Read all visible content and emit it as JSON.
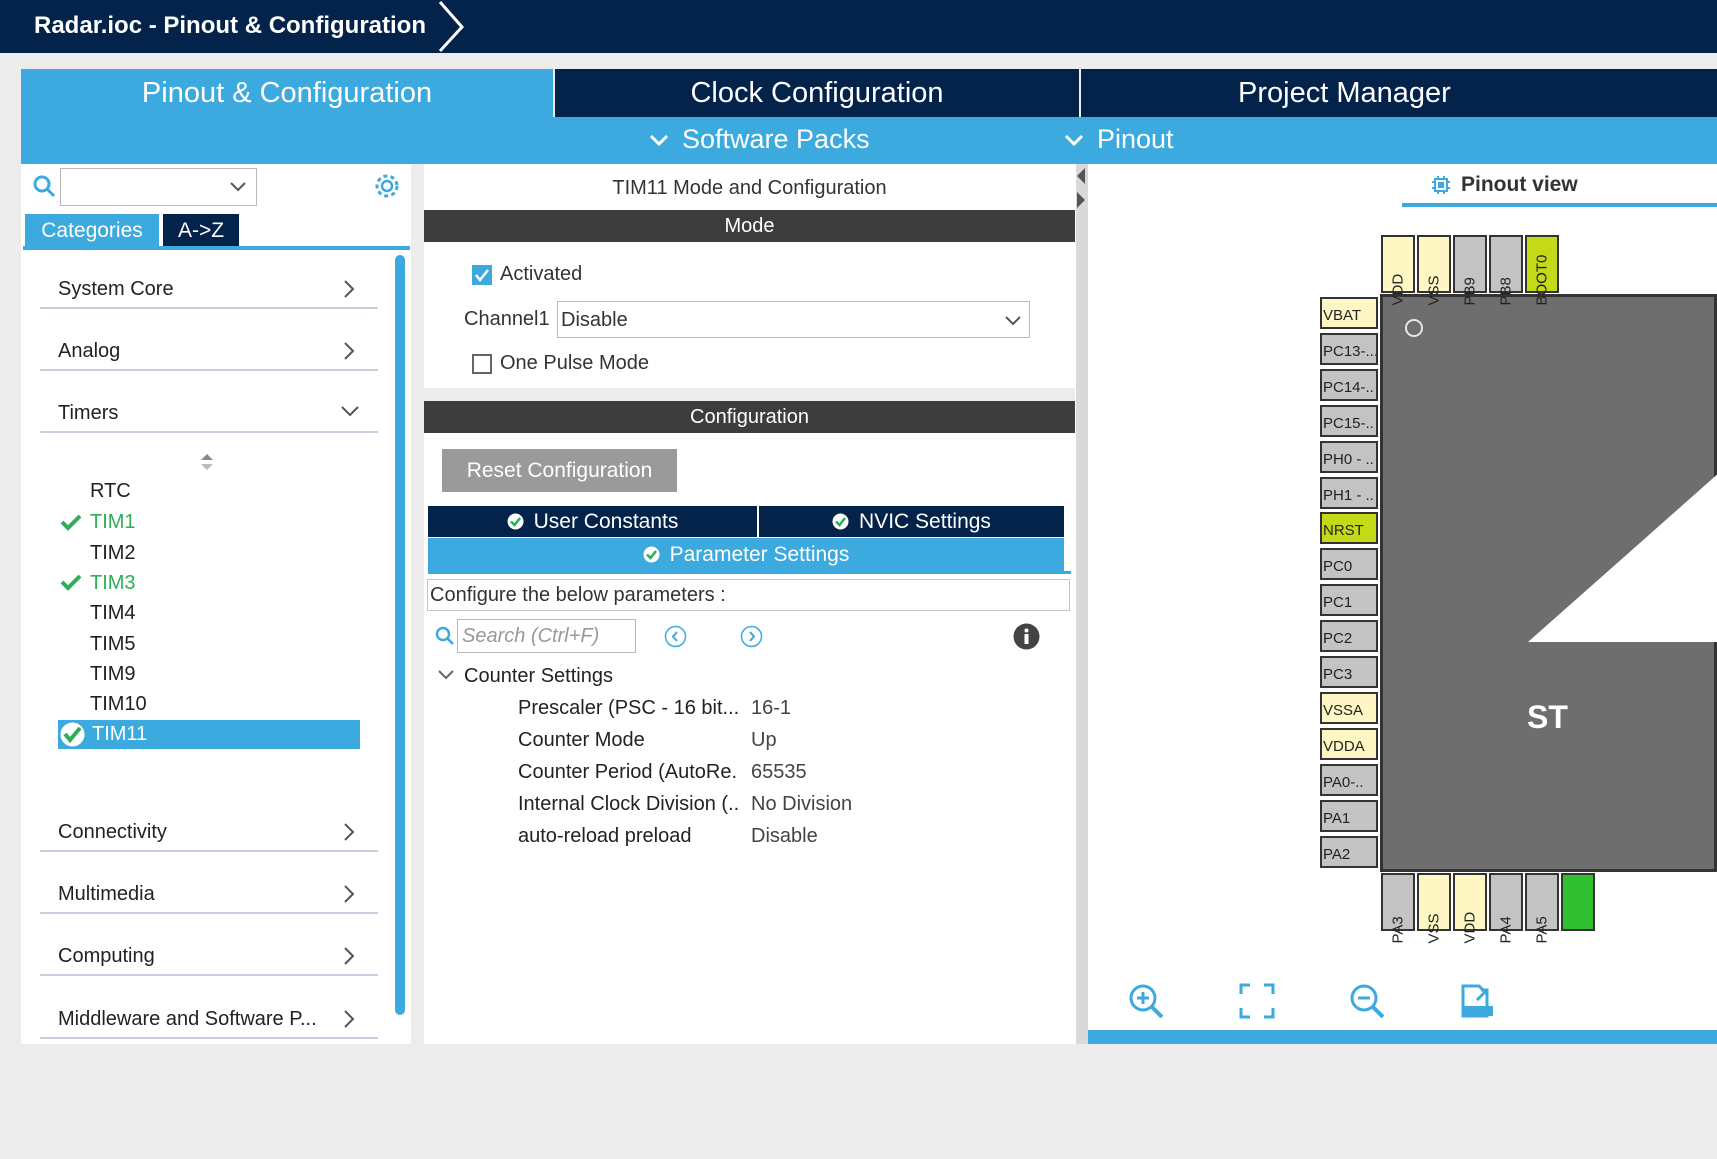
{
  "window": {
    "breadcrumb": "Radar.ioc - Pinout & Configuration"
  },
  "main_tabs": [
    {
      "label": "Pinout & Configuration",
      "active": true
    },
    {
      "label": "Clock Configuration",
      "active": false
    },
    {
      "label": "Project Manager",
      "active": false
    }
  ],
  "sub_menu": [
    {
      "label": "Software Packs",
      "icon": "chevron-down-icon"
    },
    {
      "label": "Pinout",
      "icon": "chevron-down-icon"
    }
  ],
  "left_panel": {
    "search_value": "",
    "tabs": [
      {
        "label": "Categories",
        "active": true
      },
      {
        "label": "A->Z",
        "active": false
      }
    ],
    "categories_top": [
      {
        "label": "System Core",
        "expanded": false
      },
      {
        "label": "Analog",
        "expanded": false
      },
      {
        "label": "Timers",
        "expanded": true
      }
    ],
    "timers": [
      {
        "label": "RTC",
        "enabled": false
      },
      {
        "label": "TIM1",
        "enabled": true
      },
      {
        "label": "TIM2",
        "enabled": false
      },
      {
        "label": "TIM3",
        "enabled": true
      },
      {
        "label": "TIM4",
        "enabled": false
      },
      {
        "label": "TIM5",
        "enabled": false
      },
      {
        "label": "TIM9",
        "enabled": false
      },
      {
        "label": "TIM10",
        "enabled": false
      },
      {
        "label": "TIM11",
        "enabled": true,
        "selected": true
      }
    ],
    "categories_bottom": [
      {
        "label": "Connectivity"
      },
      {
        "label": "Multimedia"
      },
      {
        "label": "Computing"
      },
      {
        "label": "Middleware and Software P..."
      }
    ]
  },
  "mode_panel": {
    "title": "TIM11 Mode and Configuration",
    "mode_header": "Mode",
    "activated_label": "Activated",
    "activated_checked": true,
    "channel1_label": "Channel1",
    "channel1_value": "Disable",
    "one_pulse_label": "One Pulse Mode",
    "one_pulse_checked": false
  },
  "configuration": {
    "header": "Configuration",
    "reset_button": "Reset Configuration",
    "tabs": [
      {
        "label": "User Constants",
        "active": false
      },
      {
        "label": "NVIC Settings",
        "active": false
      },
      {
        "label": "Parameter Settings",
        "active": true
      }
    ],
    "description": "Configure the below parameters :",
    "search_placeholder": "Search (Ctrl+F)",
    "group_label": "Counter Settings",
    "params": [
      {
        "name": "Prescaler (PSC - 16 bit...",
        "value": "16-1"
      },
      {
        "name": "Counter Mode",
        "value": "Up"
      },
      {
        "name": "Counter Period (AutoRe.",
        "value": "65535"
      },
      {
        "name": "Internal Clock Division (..",
        "value": "No Division"
      },
      {
        "name": "auto-reload preload",
        "value": "Disable"
      }
    ]
  },
  "pinout_view": {
    "title": "Pinout view",
    "chip_text": "ST",
    "top_pins": [
      {
        "label": "VDD",
        "color": "cream"
      },
      {
        "label": "VSS",
        "color": "cream"
      },
      {
        "label": "PB9",
        "color": "gray"
      },
      {
        "label": "PB8",
        "color": "gray"
      },
      {
        "label": "BOOT0",
        "color": "lime"
      }
    ],
    "left_pins": [
      {
        "label": "VBAT",
        "color": "cream"
      },
      {
        "label": "PC13-...",
        "color": "gray"
      },
      {
        "label": "PC14-..",
        "color": "gray"
      },
      {
        "label": "PC15-..",
        "color": "gray"
      },
      {
        "label": "PH0 - ..",
        "color": "gray"
      },
      {
        "label": "PH1 - ..",
        "color": "gray"
      },
      {
        "label": "NRST",
        "color": "lime"
      },
      {
        "label": "PC0",
        "color": "gray"
      },
      {
        "label": "PC1",
        "color": "gray"
      },
      {
        "label": "PC2",
        "color": "gray"
      },
      {
        "label": "PC3",
        "color": "gray"
      },
      {
        "label": "VSSA",
        "color": "cream"
      },
      {
        "label": "VDDA",
        "color": "cream"
      },
      {
        "label": "PA0-..",
        "color": "gray"
      },
      {
        "label": "PA1",
        "color": "gray"
      },
      {
        "label": "PA2",
        "color": "gray"
      }
    ],
    "bottom_pins": [
      {
        "label": "PA3",
        "color": "gray"
      },
      {
        "label": "VSS",
        "color": "cream"
      },
      {
        "label": "VDD",
        "color": "cream"
      },
      {
        "label": "PA4",
        "color": "gray"
      },
      {
        "label": "PA5",
        "color": "gray"
      },
      {
        "label": "",
        "color": "green"
      }
    ],
    "tools": [
      "zoom-in-icon",
      "fit-screen-icon",
      "zoom-out-icon",
      "export-icon"
    ]
  },
  "colors": {
    "navy": "#03234b",
    "accent": "#3ca9df",
    "dark_header": "#3d3d3d",
    "enabled_green": "#2eae58"
  }
}
